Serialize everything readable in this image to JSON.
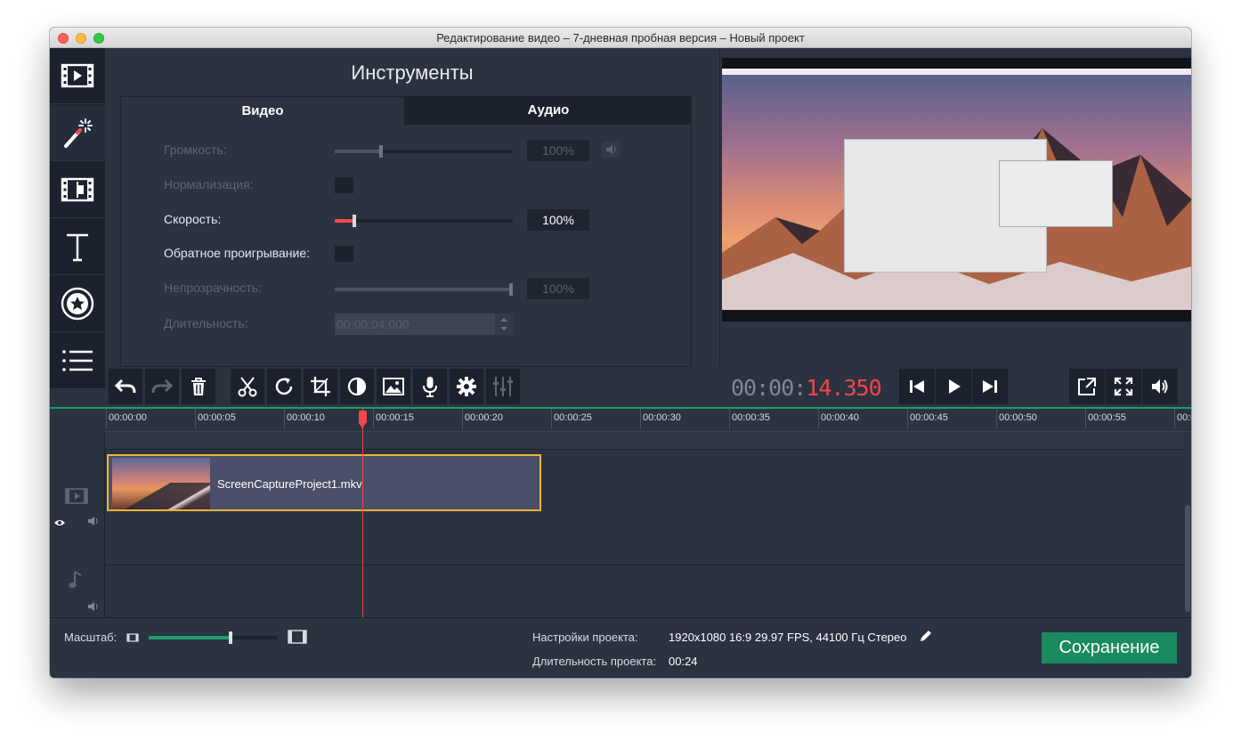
{
  "window": {
    "title": "Редактирование видео – 7-дневная пробная версия – Новый проект"
  },
  "sidebar": {
    "items": [
      {
        "icon": "video-import-icon"
      },
      {
        "icon": "magic-wand-icon"
      },
      {
        "icon": "film-transitions-icon"
      },
      {
        "icon": "text-titles-icon"
      },
      {
        "icon": "sticker-star-icon"
      },
      {
        "icon": "list-menu-icon"
      }
    ]
  },
  "tools": {
    "title": "Инструменты",
    "tabs": [
      "Видео",
      "Аудио"
    ],
    "volume": {
      "label": "Громкость:",
      "value": "100%",
      "level": 0.25
    },
    "normalization": {
      "label": "Нормализация:"
    },
    "speed": {
      "label": "Скорость:",
      "value": "100%",
      "level": 0.1
    },
    "reverse": {
      "label": "Обратное проигрывание:"
    },
    "opacity": {
      "label": "Непрозрачность:",
      "value": "100%",
      "level": 0.98
    },
    "duration": {
      "label": "Длительность:",
      "value": "00:00:04.000"
    }
  },
  "toolbar": {
    "icons": [
      "undo-icon",
      "redo-icon",
      "delete-icon",
      "cut-icon",
      "rotate-icon",
      "crop-icon",
      "color-adjust-icon",
      "image-icon",
      "microphone-icon",
      "settings-icon",
      "equalizer-icon"
    ]
  },
  "player": {
    "timecode_dim": "00:00:",
    "timecode_active": "14.350",
    "progress": 0.59
  },
  "timeline": {
    "ticks": [
      "00:00:00",
      "00:00:05",
      "00:00:10",
      "00:00:15",
      "00:00:20",
      "00:00:25",
      "00:00:30",
      "00:00:35",
      "00:00:40",
      "00:00:45",
      "00:00:50",
      "00:00:55",
      "00:0"
    ],
    "clip": {
      "name": "ScreenCaptureProject1.mkv"
    }
  },
  "bottom": {
    "zoom_label": "Масштаб:",
    "zoom_level": 0.62,
    "project_settings_label": "Настройки проекта:",
    "project_settings_value": "1920x1080 16:9 29.97 FPS, 44100 Гц Стерео",
    "project_duration_label": "Длительность проекта:",
    "project_duration_value": "00:24",
    "save_label": "Сохранение"
  },
  "colors": {
    "accent_red": "#f24848",
    "accent_green": "#1a8a5f",
    "clip_border": "#f0b233"
  }
}
